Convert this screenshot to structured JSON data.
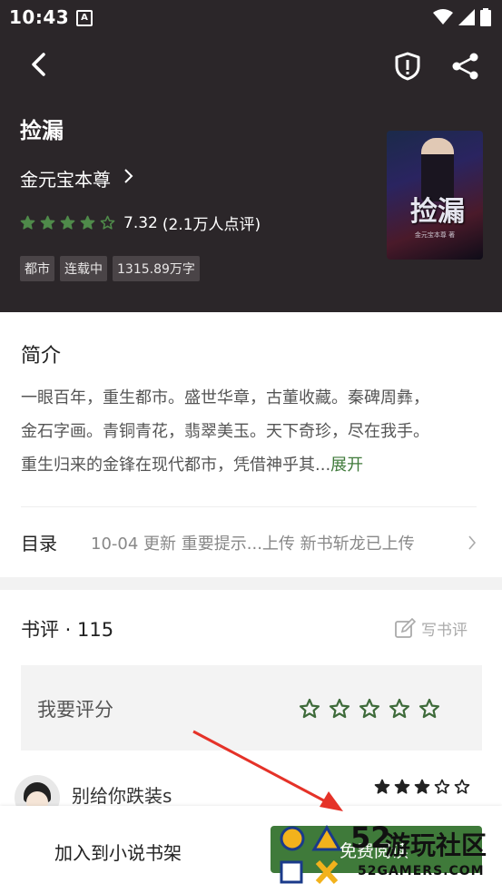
{
  "status_bar": {
    "time": "10:43",
    "notif_letter": "A"
  },
  "book": {
    "title": "捡漏",
    "author": "金元宝本尊",
    "rating": "7.32",
    "rating_count": "(2.1万人点评)",
    "stars_filled": 4,
    "stars_total": 5,
    "tags": [
      "都市",
      "连载中",
      "1315.89万字"
    ],
    "cover_title": "捡漏",
    "cover_sub": "金元宝本尊 著"
  },
  "intro": {
    "heading": "简介",
    "lines": [
      "一眼百年，重生都市。盛世华章，古董收藏。秦碑周彝，",
      "金石字画。青铜青花，翡翠美玉。天下奇珍，尽在我手。",
      "重生归来的金锋在现代都市，凭借神乎其..."
    ],
    "expand": "展开"
  },
  "toc": {
    "label": "目录",
    "update": "10-04  更新  重要提示...上传 新书斩龙已上传"
  },
  "reviews": {
    "heading": "书评 · 115",
    "write": "写书评",
    "score_label": "我要评分",
    "comment": {
      "name": "别给你跌装s",
      "stars_filled": 3,
      "stars_total": 5
    }
  },
  "bottom": {
    "add_shelf": "加入到小说书架",
    "read": "免费阅读"
  },
  "watermark": {
    "number": "52",
    "text": "游玩社区",
    "site": "52GAMERS.COM"
  },
  "colors": {
    "header_bg": "#2b2629",
    "accent": "#3f7a3a",
    "star_green": "#4f8a4a"
  }
}
